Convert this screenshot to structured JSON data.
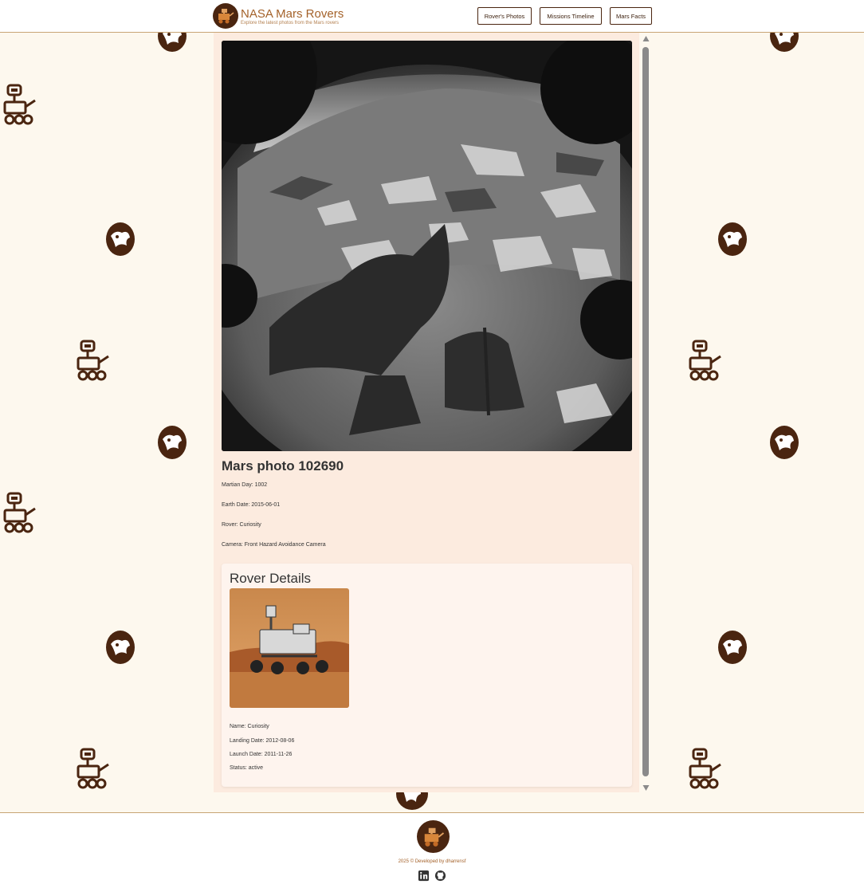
{
  "header": {
    "title": "NASA Mars Rovers",
    "subtitle": "Explore the latest photos from the Mars rovers",
    "nav": [
      {
        "label": "Rover's Photos"
      },
      {
        "label": "Missions Timeline"
      },
      {
        "label": "Mars Facts"
      }
    ]
  },
  "photo": {
    "title": "Mars photo 102690",
    "fields": [
      {
        "label": "Martian Day:",
        "value": "1002",
        "text": "Martian Day: 1002"
      },
      {
        "label": "Earth Date:",
        "value": "2015-06-01",
        "text": "Earth Date: 2015-06-01"
      },
      {
        "label": "Rover:",
        "value": "Curiosity",
        "text": "Rover: Curiosity"
      },
      {
        "label": "Camera:",
        "value": "Front Hazard Avoidance Camera",
        "text": "Camera: Front Hazard Avoidance Camera"
      }
    ]
  },
  "rover_details": {
    "title": "Rover Details",
    "fields": [
      {
        "text": "Name: Curiosity"
      },
      {
        "text": "Landing Date: 2012-08-06"
      },
      {
        "text": "Launch Date: 2011-11-26"
      },
      {
        "text": "Status: active"
      }
    ]
  },
  "footer": {
    "credit": "2025 © Developed by dharrensf",
    "links": [
      {
        "icon": "linkedin-icon"
      },
      {
        "icon": "github-icon"
      }
    ]
  },
  "colors": {
    "brand": "#a4622a",
    "dark_brown": "#4a2510",
    "panel": "#fcebdf",
    "background": "#fdf8ee"
  }
}
